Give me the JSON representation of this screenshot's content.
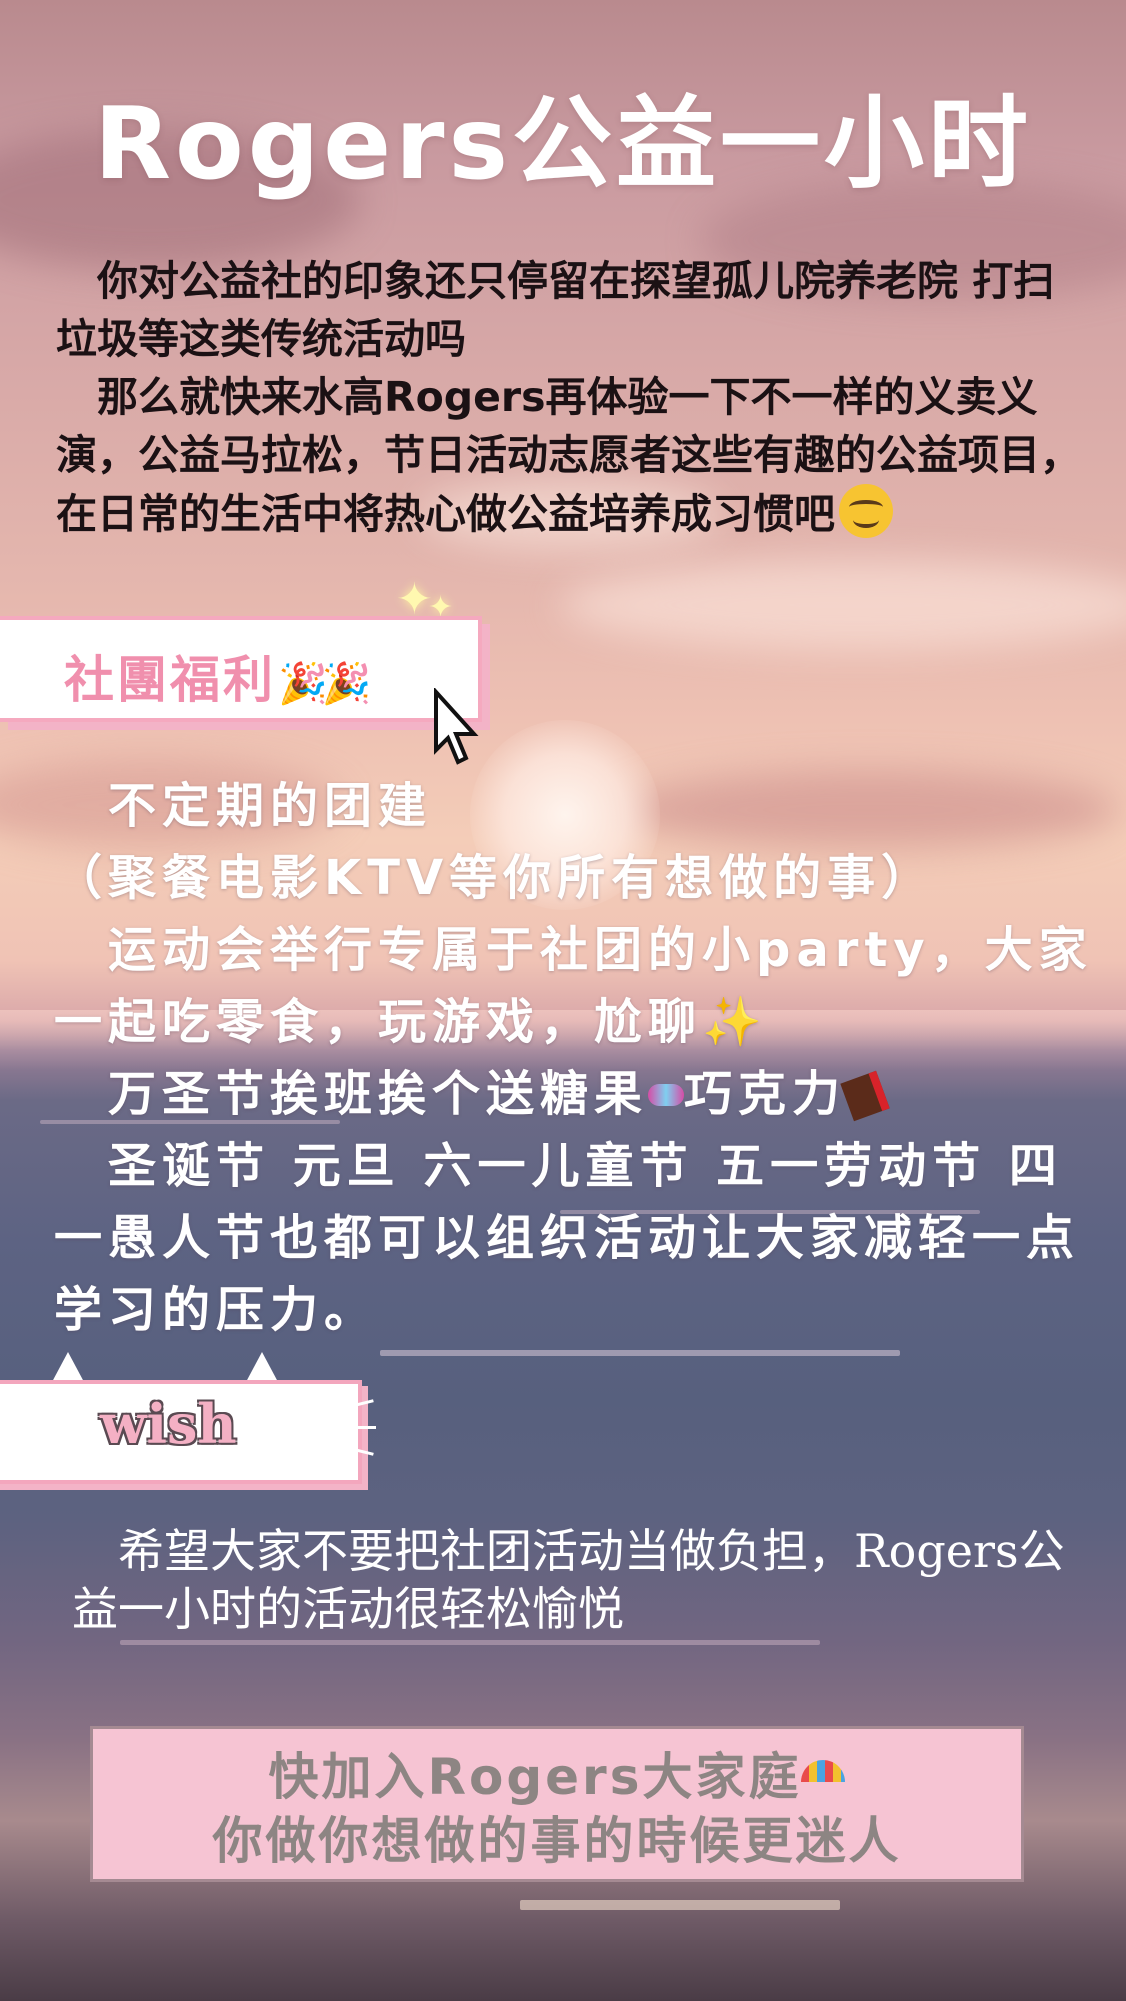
{
  "title": "Rogers公益一小时",
  "intro": {
    "line1": "你对公益社的印象还只停留在探望孤儿院养老院 打扫垃圾等这类传统活动吗",
    "line2": "那么就快来水高Rogers再体验一下不一样的义卖义演，公益马拉松，节日活动志愿者这些有趣的公益项目，在日常的生活中将热心做公益培养成习惯吧",
    "emoji_icon": "smiling-face-icon"
  },
  "welfare": {
    "title": "社團福利",
    "title_icon": "party-popper-icon",
    "items": [
      "不定期的团建",
      "（聚餐电影KTV等你所有想做的事）",
      "运动会举行专属于社团的小party，大家一起吃零食，玩游戏，尬聊",
      "万圣节挨班挨个送糖果",
      "巧克力",
      "圣诞节  元旦  六一儿童节  五一劳动节  四一愚人节也都可以组织活动让大家减轻一点学习的压力。"
    ],
    "icons": [
      "sparkles-icon",
      "candy-icon",
      "chocolate-icon",
      "cursor-icon"
    ]
  },
  "wish": {
    "label": "wish",
    "body": "希望大家不要把社团活动当做负担，Rogers公益一小时的活动很轻松愉悦"
  },
  "cta": {
    "line1": "快加入Rogers大家庭",
    "line2": "你做你想做的事的時候更迷人",
    "icon": "umbrella-icon"
  },
  "colors": {
    "title_text": "#ffffff",
    "intro_text": "#1b1114",
    "welfare_title": "#f08fad",
    "box_border_pink": "#f5a9bf",
    "cta_background": "#f6c4d3",
    "cta_text": "#8d8583"
  }
}
